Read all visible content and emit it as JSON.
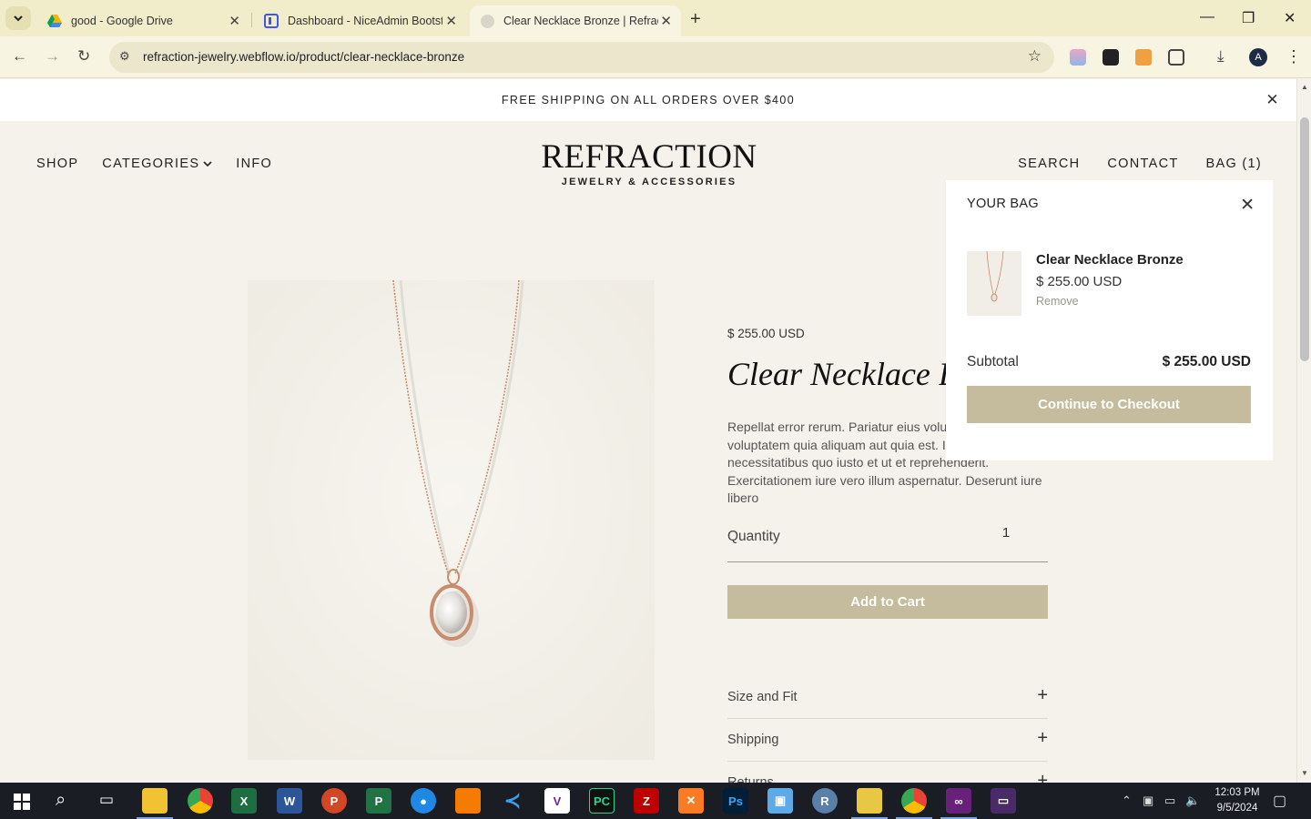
{
  "browser": {
    "tabs": [
      {
        "title": "good - Google Drive",
        "icon": "google-drive-icon"
      },
      {
        "title": "Dashboard - NiceAdmin Bootstrap",
        "icon": "niceadmin-icon"
      },
      {
        "title": "Clear Necklace Bronze | Refraction",
        "icon": "webflow-icon"
      }
    ],
    "url": "refraction-jewelry.webflow.io/product/clear-necklace-bronze",
    "profile_initial": "A"
  },
  "site": {
    "announcement": "FREE SHIPPING ON ALL ORDERS OVER $400",
    "nav_left": {
      "shop": "SHOP",
      "categories": "CATEGORIES",
      "info": "INFO"
    },
    "logo": {
      "main": "REFRACTION",
      "sub": "JEWELRY & ACCESSORIES"
    },
    "nav_right": {
      "search": "SEARCH",
      "contact": "CONTACT",
      "bag": "BAG (1)"
    }
  },
  "product": {
    "price": "$ 255.00 USD",
    "title": "Clear Necklace Bronze",
    "description": "Repellat error rerum. Pariatur eius voluptatem ut voluptatem quia aliquam aut quia est. Id ea necessitatibus quo iusto et ut et reprehenderit. Exercitationem iure vero illum aspernatur. Deserunt iure libero",
    "quantity_label": "Quantity",
    "quantity_value": "1",
    "add_to_cart": "Add to Cart",
    "accordion": [
      "Size and Fit",
      "Shipping",
      "Returns"
    ]
  },
  "cart": {
    "heading": "YOUR BAG",
    "item_name": "Clear Necklace Bronze",
    "item_price": "$ 255.00 USD",
    "remove": "Remove",
    "subtotal_label": "Subtotal",
    "subtotal_value": "$ 255.00 USD",
    "checkout": "Continue to Checkout"
  },
  "taskbar": {
    "time": "12:03 PM",
    "date": "9/5/2024"
  },
  "colors": {
    "accent": "#c4bc9c",
    "page_bg": "#f4f2ea",
    "chrome_bg": "#f1ecc9"
  }
}
